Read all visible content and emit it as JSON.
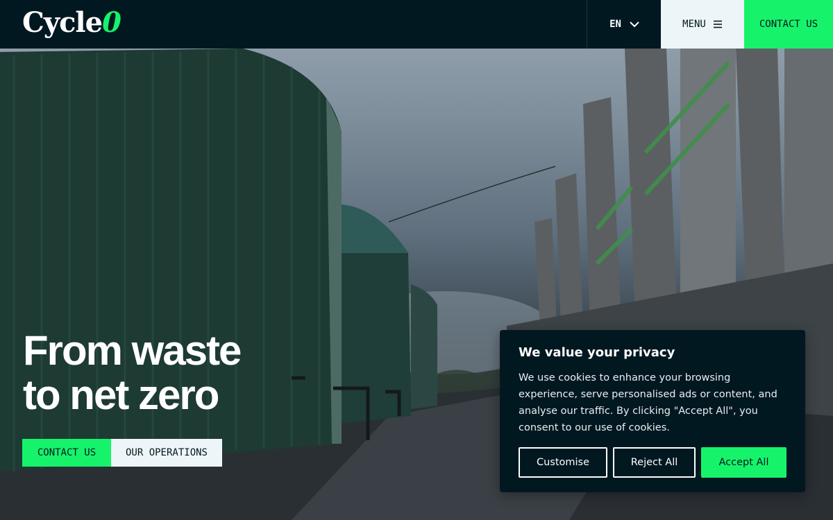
{
  "header": {
    "logo_text": "Cycle",
    "logo_accent": "0",
    "language": "EN",
    "menu_label": "MENU",
    "contact_label": "CONTACT US"
  },
  "hero": {
    "headline_line1": "From waste",
    "headline_line2": "to net zero",
    "cta_contact": "CONTACT US",
    "cta_operations": "OUR OPERATIONS"
  },
  "cookie": {
    "title": "We value your privacy",
    "body": "We use cookies to enhance your browsing experience, serve personalised ads or content, and analyse our traffic. By clicking \"Accept All\", you consent to our use of cookies.",
    "customise_label": "Customise",
    "reject_label": "Reject All",
    "accept_label": "Accept All"
  },
  "icons": {
    "language_chevron": "chevron-down-icon",
    "menu": "hamburger-icon"
  },
  "colors": {
    "brand_dark": "#021821",
    "accent_green": "#16f36b",
    "light_button": "#eef5f8"
  }
}
